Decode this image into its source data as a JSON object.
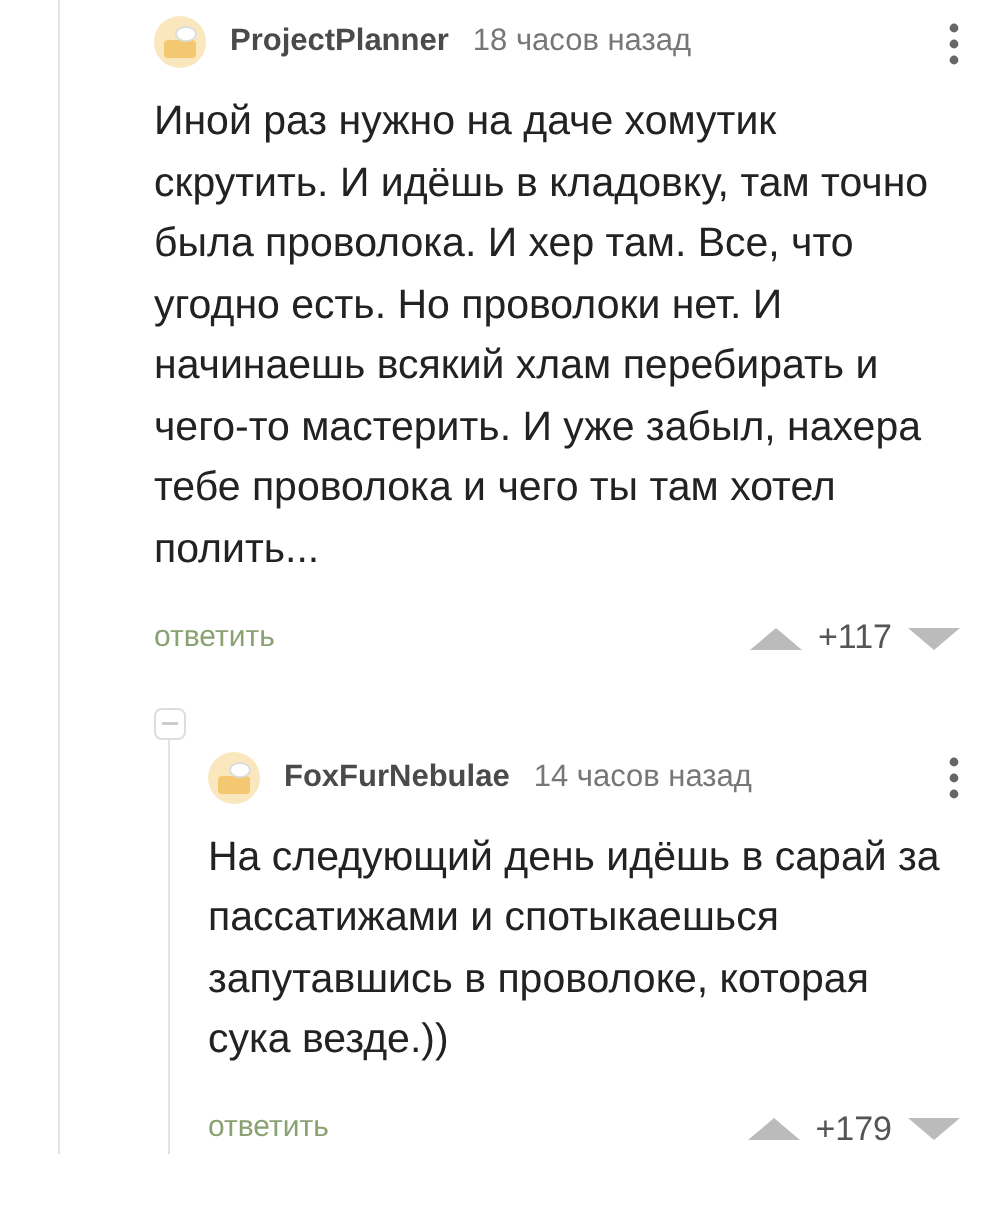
{
  "comments": [
    {
      "author": "ProjectPlanner",
      "time": "18 часов назад",
      "text": "Иной раз нужно на даче хомутик скрутить. И идёшь в кладовку, там точно была проволока. И хер там. Все, что угодно есть. Но проволоки нет. И начинаешь всякий хлам перебирать и чего-то мастерить. И уже забыл, нахера тебе проволока и чего ты там хотел полить...",
      "reply": "ответить",
      "rating": "+117",
      "replies": [
        {
          "author": "FoxFurNebulae",
          "time": "14 часов назад",
          "text": "На следующий день идёшь в сарай за пассатижами и спотыкаешься запутавшись в проволоке, которая сука везде.))",
          "reply": "ответить",
          "rating": "+179"
        }
      ]
    }
  ]
}
